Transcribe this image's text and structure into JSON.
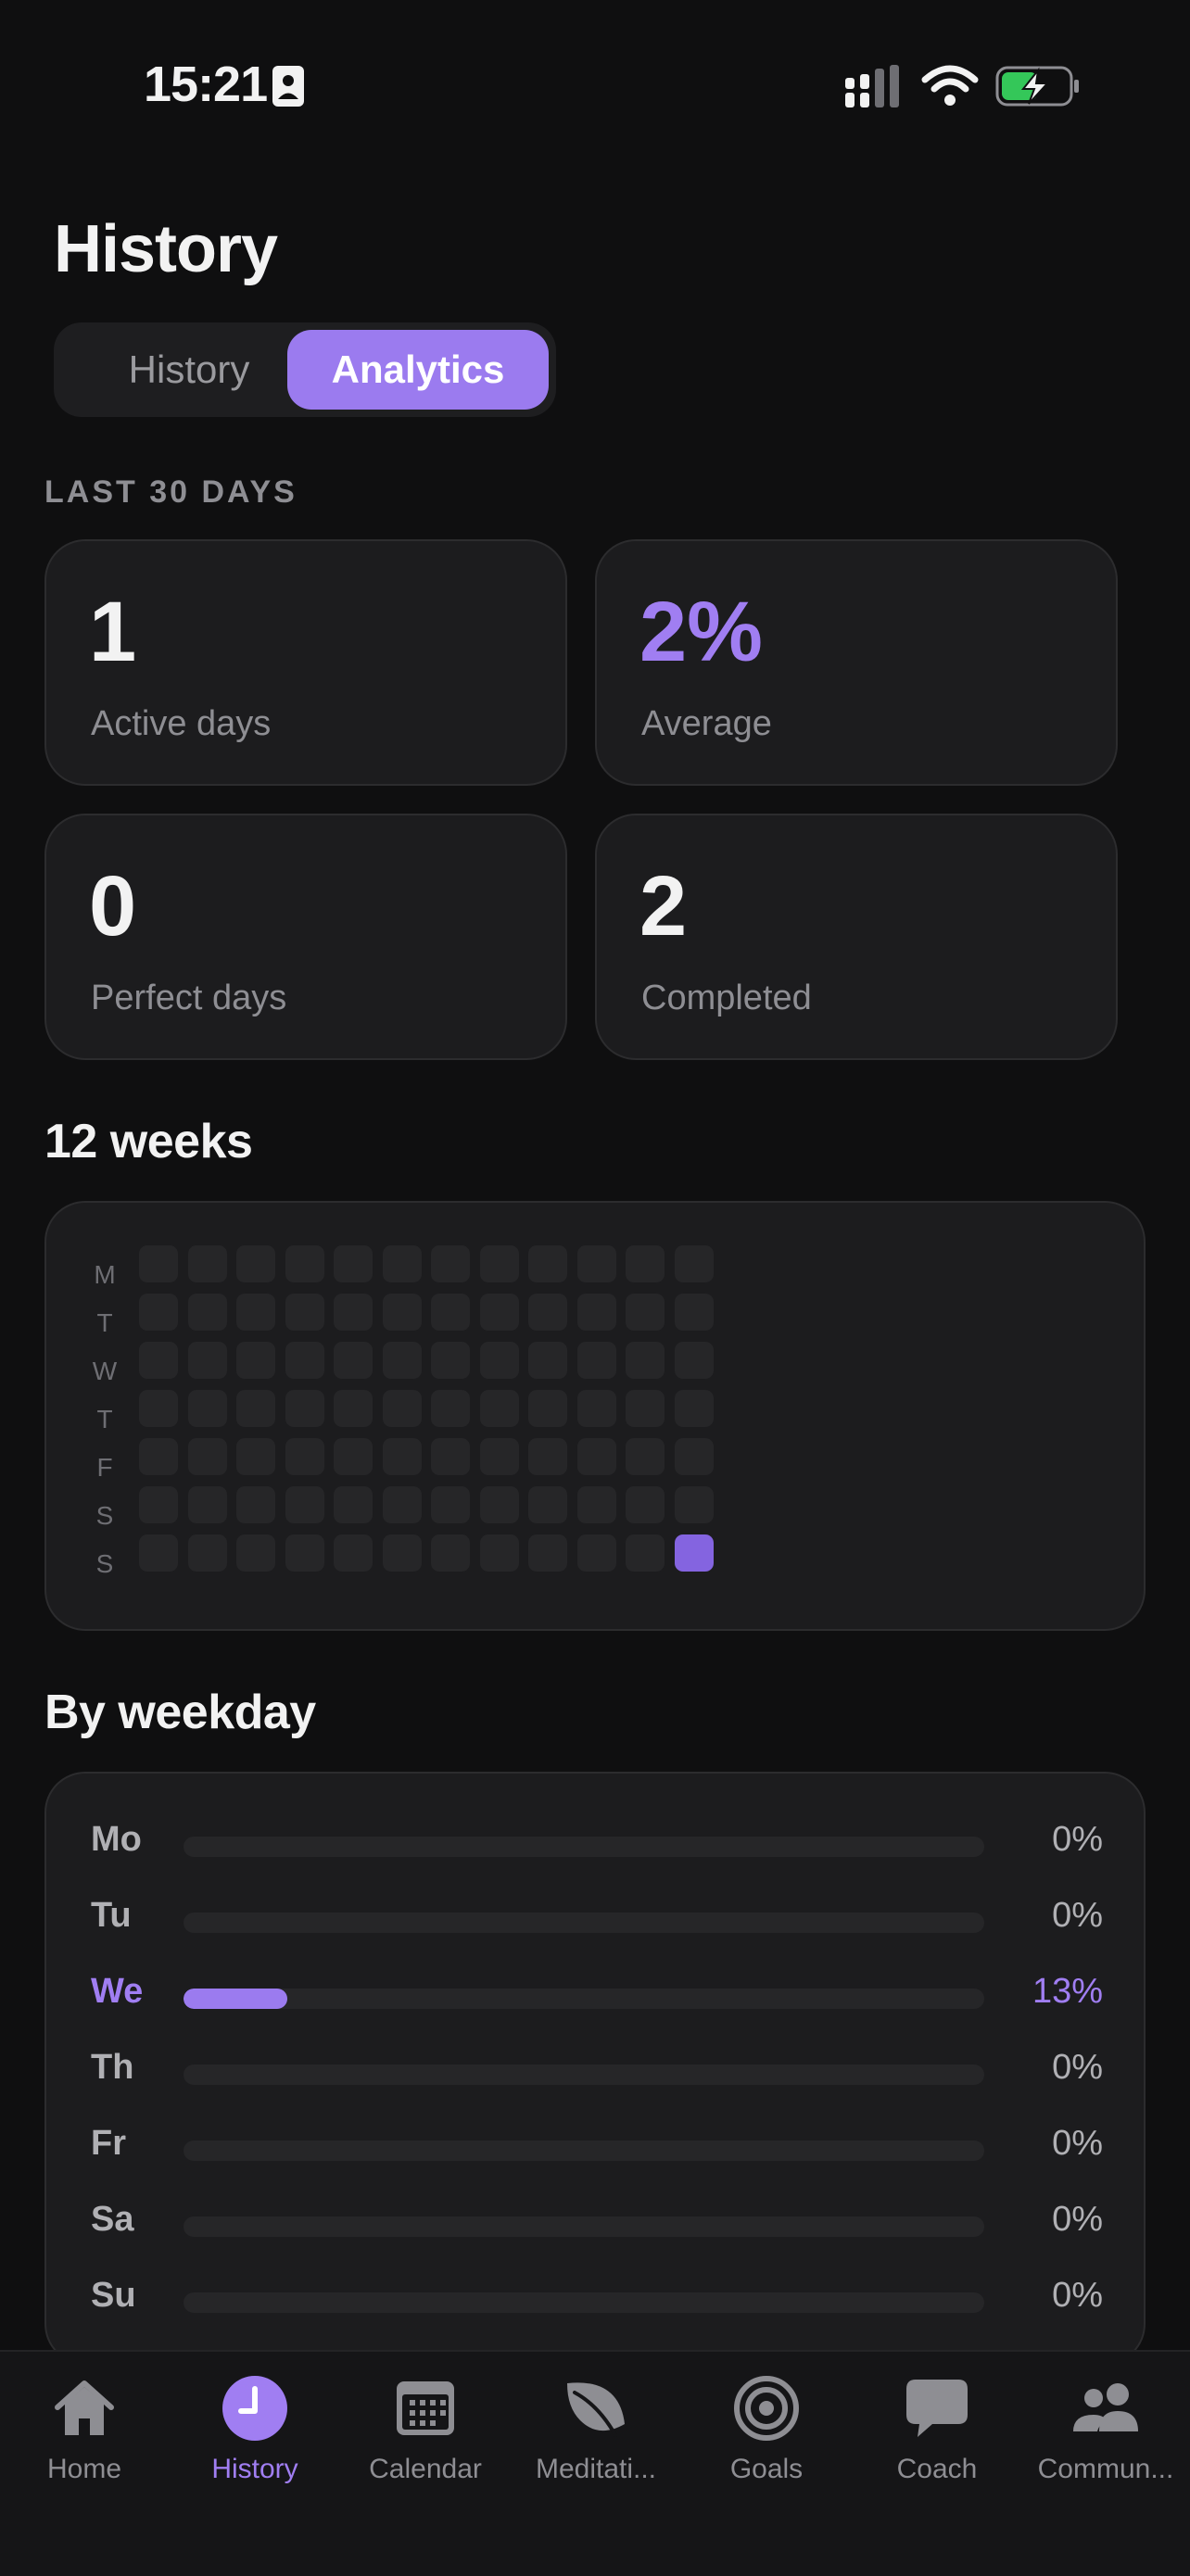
{
  "status_bar": {
    "time": "15:21",
    "icons": [
      "contact-card-icon",
      "cellular-signal-icon",
      "wifi-icon",
      "battery-charging-icon"
    ]
  },
  "header": {
    "title": "History",
    "segments": {
      "history": "History",
      "analytics": "Analytics",
      "selected": "Analytics"
    }
  },
  "summary": {
    "caption": "LAST 30 DAYS",
    "stats": [
      {
        "value": "1",
        "label": "Active days"
      },
      {
        "value": "2%",
        "label": "Average"
      },
      {
        "value": "0",
        "label": "Perfect days"
      },
      {
        "value": "2",
        "label": "Completed"
      }
    ]
  },
  "heatmap": {
    "title": "12 weeks",
    "day_labels": [
      "M",
      "T",
      "W",
      "T",
      "F",
      "S",
      "S"
    ],
    "weeks": 12,
    "active_cells": [
      {
        "week": 12,
        "day": 7
      }
    ]
  },
  "weekday": {
    "title": "By weekday",
    "rows": [
      {
        "day": "Mo",
        "percent_text": "0%",
        "value": 0
      },
      {
        "day": "Tu",
        "percent_text": "0%",
        "value": 0
      },
      {
        "day": "We",
        "percent_text": "13%",
        "value": 13,
        "highlight": true
      },
      {
        "day": "Th",
        "percent_text": "0%",
        "value": 0
      },
      {
        "day": "Fr",
        "percent_text": "0%",
        "value": 0
      },
      {
        "day": "Sa",
        "percent_text": "0%",
        "value": 0
      },
      {
        "day": "Su",
        "percent_text": "0%",
        "value": 0
      }
    ]
  },
  "tabbar": {
    "items": [
      {
        "label": "Home",
        "icon": "home-icon"
      },
      {
        "label": "History",
        "icon": "history-clock-icon",
        "active": true
      },
      {
        "label": "Calendar",
        "icon": "calendar-icon"
      },
      {
        "label": "Meditati...",
        "icon": "leaf-icon"
      },
      {
        "label": "Goals",
        "icon": "target-icon"
      },
      {
        "label": "Coach",
        "icon": "chat-bubble-icon"
      },
      {
        "label": "Commun...",
        "icon": "people-icon"
      }
    ]
  },
  "colors": {
    "background": "#0f0f10",
    "card": "#1c1c1e",
    "accent": "#9b7bef",
    "heatmap_active": "#8464e0"
  }
}
